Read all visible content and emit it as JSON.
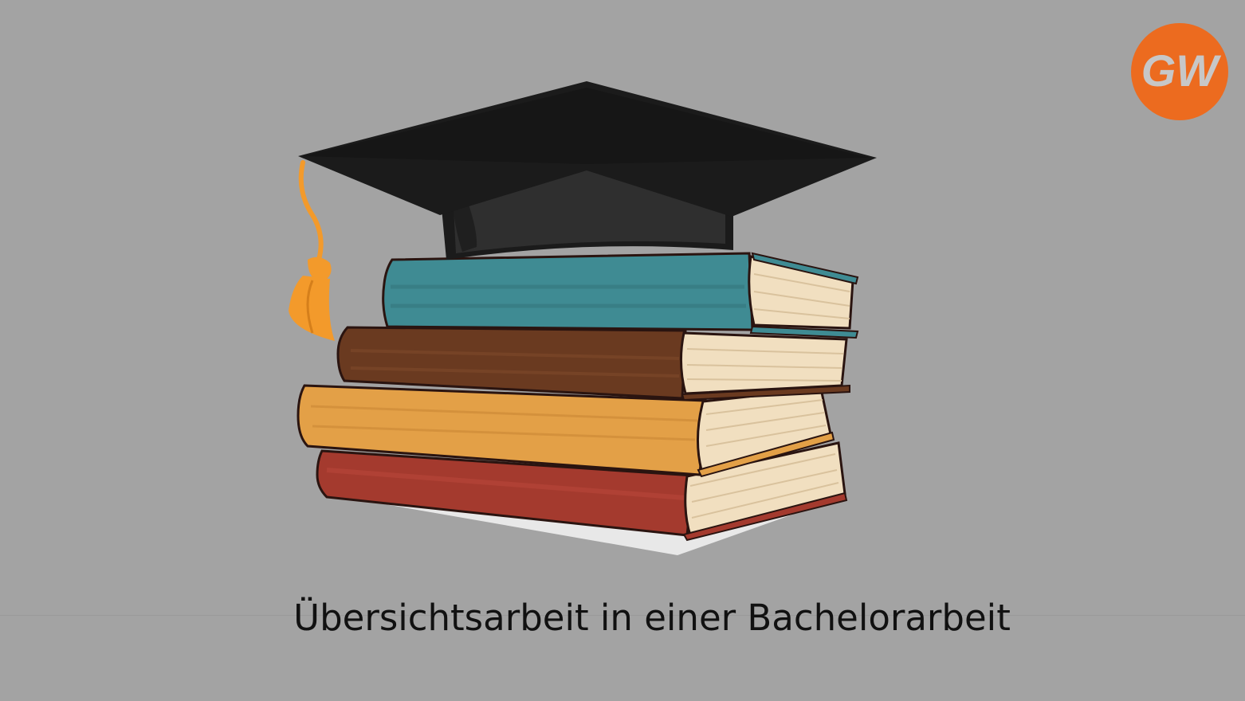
{
  "caption": {
    "text": "Übersichtsarbeit in einer Bachelorarbeit"
  },
  "logo": {
    "text": "GW",
    "color": "#ec6b1f"
  },
  "illustration": {
    "icon": "graduation-cap-on-books-icon",
    "books": [
      {
        "name": "top-book",
        "color": "#3f8b93"
      },
      {
        "name": "second-book",
        "color": "#6a3a20"
      },
      {
        "name": "third-book",
        "color": "#e3a047"
      },
      {
        "name": "bottom-book",
        "color": "#a43a2e"
      }
    ],
    "cap_color": "#1b1b1b",
    "tassel_color": "#f39a2b"
  },
  "colors": {
    "background": "#a3a3a3"
  }
}
